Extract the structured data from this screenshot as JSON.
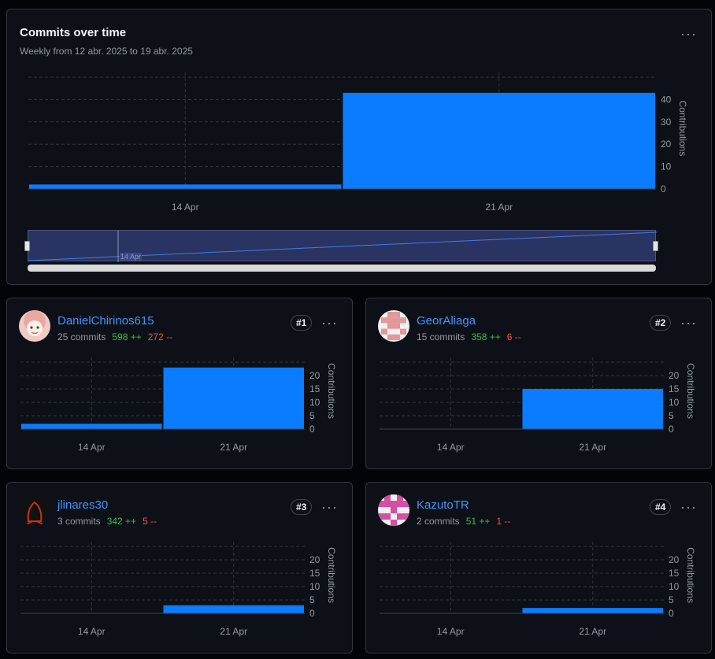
{
  "overview": {
    "title": "Commits over time",
    "subtitle": "Weekly from 12 abr. 2025 to 19 abr. 2025",
    "more_label": "···",
    "brush_label": "14 Apr"
  },
  "colors": {
    "bar": "#0a7cff",
    "grid": "#30363d",
    "axis_text": "#9198a1",
    "adds": "#3fb950",
    "dels": "#f85149",
    "link": "#4493f8"
  },
  "contributors": [
    {
      "name": "DanielChirinos615",
      "commits": "25 commits",
      "additions": "598 ++",
      "deletions": "272 --",
      "rank": "#1",
      "more_label": "···",
      "avatar_icon": "anime-avatar-icon"
    },
    {
      "name": "GeorAliaga",
      "commits": "15 commits",
      "additions": "358 ++",
      "deletions": "6 --",
      "rank": "#2",
      "more_label": "···",
      "avatar_icon": "identicon-pink-icon"
    },
    {
      "name": "jlinares30",
      "commits": "3 commits",
      "additions": "342 ++",
      "deletions": "5 --",
      "rank": "#3",
      "more_label": "···",
      "avatar_icon": "dark-silhouette-avatar-icon"
    },
    {
      "name": "KazutoTR",
      "commits": "2 commits",
      "additions": "51 ++",
      "deletions": "1 --",
      "rank": "#4",
      "more_label": "···",
      "avatar_icon": "identicon-magenta-icon"
    }
  ],
  "chart_data": [
    {
      "id": "overview",
      "type": "bar",
      "categories": [
        "14 Apr",
        "21 Apr"
      ],
      "values": [
        2,
        43
      ],
      "ylabel": "Contributions",
      "yticks": [
        0,
        10,
        20,
        30,
        40
      ],
      "ylim": [
        0,
        50
      ],
      "grid": true
    },
    {
      "id": "DanielChirinos615",
      "type": "bar",
      "categories": [
        "14 Apr",
        "21 Apr"
      ],
      "values": [
        2,
        23
      ],
      "ylabel": "Contributions",
      "yticks": [
        0,
        5,
        10,
        15,
        20
      ],
      "ylim": [
        0,
        25
      ],
      "grid": true
    },
    {
      "id": "GeorAliaga",
      "type": "bar",
      "categories": [
        "14 Apr",
        "21 Apr"
      ],
      "values": [
        0,
        15
      ],
      "ylabel": "Contributions",
      "yticks": [
        0,
        5,
        10,
        15,
        20
      ],
      "ylim": [
        0,
        25
      ],
      "grid": true
    },
    {
      "id": "jlinares30",
      "type": "bar",
      "categories": [
        "14 Apr",
        "21 Apr"
      ],
      "values": [
        0,
        3
      ],
      "ylabel": "Contributions",
      "yticks": [
        0,
        5,
        10,
        15,
        20
      ],
      "ylim": [
        0,
        25
      ],
      "grid": true
    },
    {
      "id": "KazutoTR",
      "type": "bar",
      "categories": [
        "14 Apr",
        "21 Apr"
      ],
      "values": [
        0,
        2
      ],
      "ylabel": "Contributions",
      "yticks": [
        0,
        5,
        10,
        15,
        20
      ],
      "ylim": [
        0,
        25
      ],
      "grid": true
    }
  ]
}
